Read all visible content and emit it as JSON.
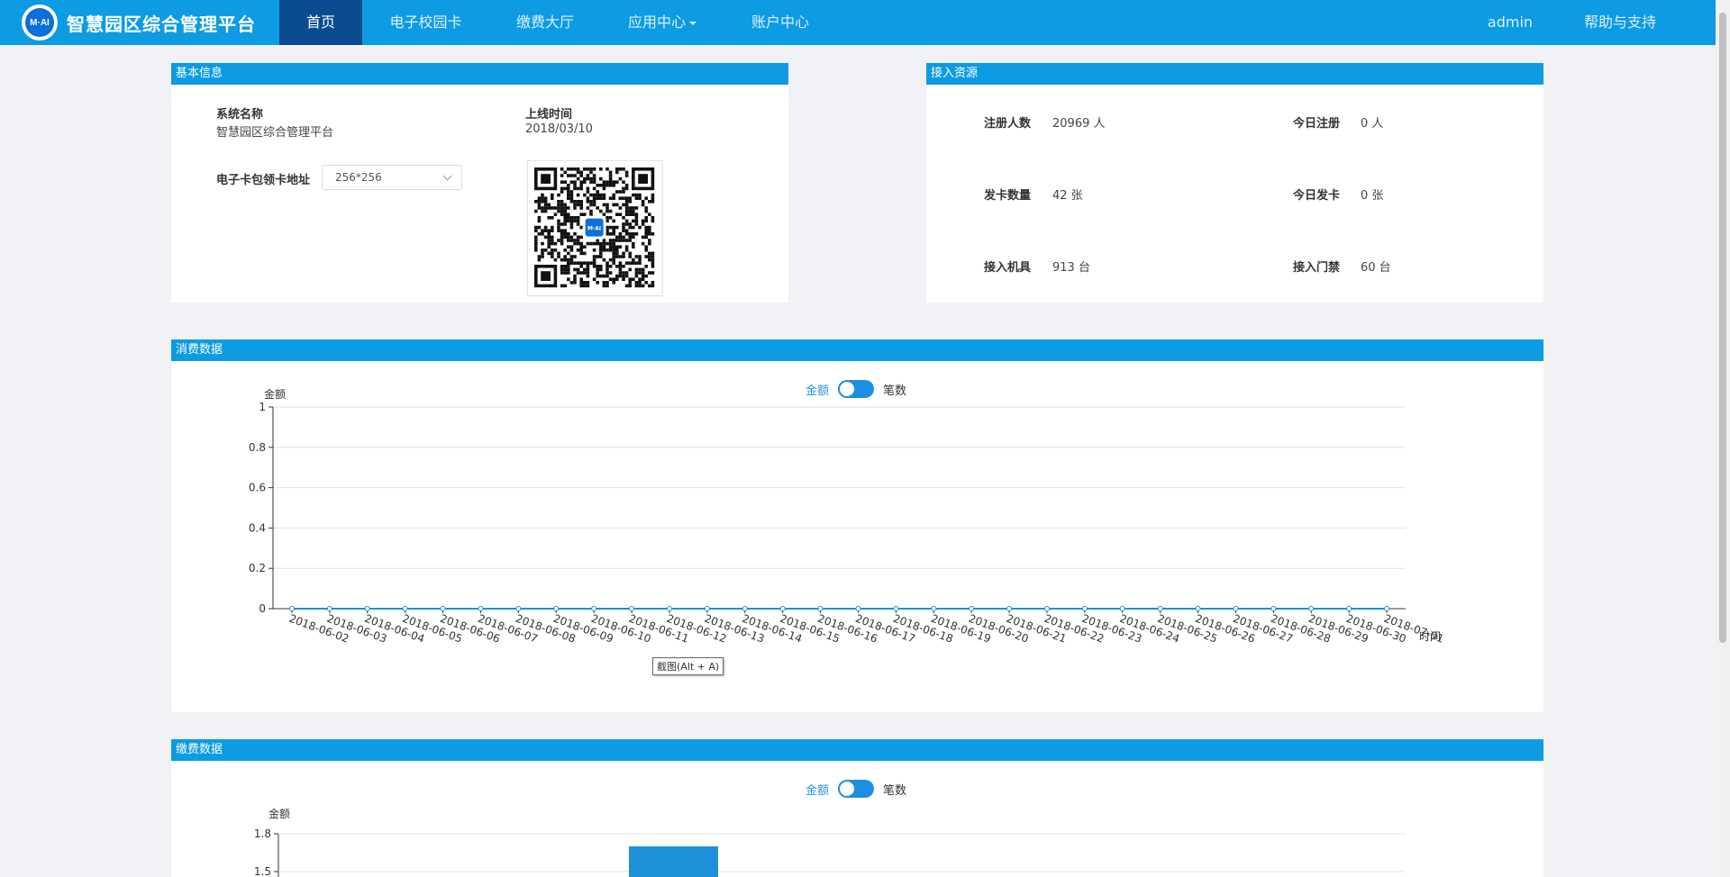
{
  "nav": {
    "brand_logo_text": "M·AI",
    "brand_title": "智慧园区综合管理平台",
    "items": [
      {
        "label": "首页",
        "active": true
      },
      {
        "label": "电子校园卡"
      },
      {
        "label": "缴费大厅"
      },
      {
        "label": "应用中心"
      },
      {
        "label": "账户中心"
      }
    ],
    "user": "admin",
    "help": "帮助与支持"
  },
  "basic_info": {
    "title": "基本信息",
    "system_name_label": "系统名称",
    "system_name_value": "智慧园区综合管理平台",
    "online_time_label": "上线时间",
    "online_time_value": "2018/03/10",
    "card_address_label": "电子卡包领卡地址",
    "card_size_selected": "256*256",
    "qr_logo_text": "M·AI"
  },
  "access": {
    "title": "接入资源",
    "stats": [
      {
        "label": "注册人数",
        "value": "20969 人"
      },
      {
        "label": "今日注册",
        "value": "0 人"
      },
      {
        "label": "发卡数量",
        "value": "42 张"
      },
      {
        "label": "今日发卡",
        "value": "0 张"
      },
      {
        "label": "接入机具",
        "value": "913 台"
      },
      {
        "label": "接入门禁",
        "value": "60 台"
      }
    ]
  },
  "consumption": {
    "title": "消费数据",
    "toggle_left": "金额",
    "toggle_right": "笔数"
  },
  "payment": {
    "title": "缴费数据",
    "toggle_left": "金额",
    "toggle_right": "笔数"
  },
  "tooltip": "截图(Alt + A)",
  "colors": {
    "nav_bg": "#0d9be3",
    "nav_active": "#0b4b8f",
    "panel_head": "#0d9be3",
    "series": "#1e90d8"
  },
  "chart_data": [
    {
      "type": "line",
      "ylabel": "金额",
      "xlabel": "时间",
      "ylim": [
        0,
        1
      ],
      "yticks": [
        "0",
        "0.2",
        "0.4",
        "0.6",
        "0.8",
        "1"
      ],
      "categories": [
        "2018-06-02",
        "2018-06-03",
        "2018-06-04",
        "2018-06-05",
        "2018-06-06",
        "2018-06-07",
        "2018-06-08",
        "2018-06-09",
        "2018-06-10",
        "2018-06-11",
        "2018-06-12",
        "2018-06-13",
        "2018-06-14",
        "2018-06-15",
        "2018-06-16",
        "2018-06-17",
        "2018-06-18",
        "2018-06-19",
        "2018-06-20",
        "2018-06-21",
        "2018-06-22",
        "2018-06-23",
        "2018-06-24",
        "2018-06-25",
        "2018-06-26",
        "2018-06-27",
        "2018-06-28",
        "2018-06-29",
        "2018-06-30",
        "2018-07-01"
      ],
      "values": [
        0,
        0,
        0,
        0,
        0,
        0,
        0,
        0,
        0,
        0,
        0,
        0,
        0,
        0,
        0,
        0,
        0,
        0,
        0,
        0,
        0,
        0,
        0,
        0,
        0,
        0,
        0,
        0,
        0,
        0
      ]
    },
    {
      "type": "bar",
      "ylabel": "金额",
      "ylim": [
        0,
        1.8
      ],
      "yticks": [
        "1.5",
        "1.8"
      ],
      "visible_bar_value": 1.7
    }
  ]
}
